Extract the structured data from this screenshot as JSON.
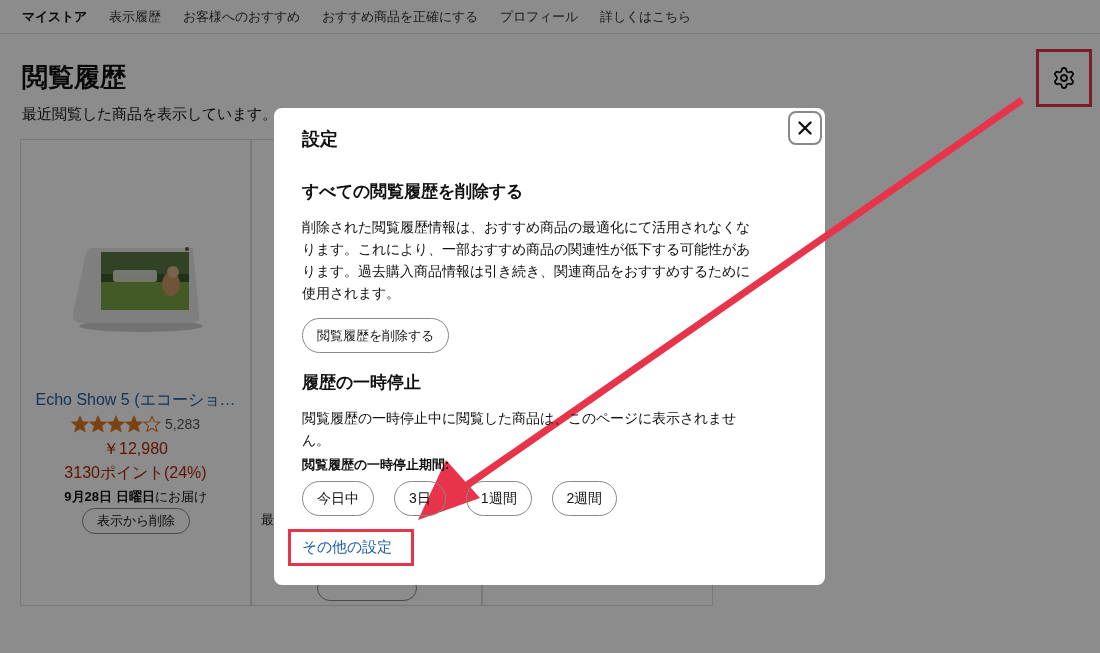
{
  "nav": {
    "items": [
      {
        "label": "マイストア",
        "selected": true
      },
      {
        "label": "表示履歴",
        "selected": false
      },
      {
        "label": "お客様へのおすすめ",
        "selected": false
      },
      {
        "label": "おすすめ商品を正確にする",
        "selected": false
      },
      {
        "label": "プロフィール",
        "selected": false
      },
      {
        "label": "詳しくはこちら",
        "selected": false
      }
    ]
  },
  "page": {
    "title": "閲覧履歴",
    "subtitle": "最近閲覧した商品を表示しています。"
  },
  "products": [
    {
      "kind": "full",
      "name": "Echo Show 5 (エコーショ…",
      "stars": 4,
      "reviews": "5,283",
      "price": "￥12,980",
      "points": "3130ポイント(24%)",
      "delivery_date": "9月28日 日曜日",
      "delivery_suffix": "にお届け",
      "remove": "表示から削除"
    },
    {
      "kind": "covered",
      "text": "最"
    },
    {
      "kind": "empty"
    }
  ],
  "dialog": {
    "title": "設定",
    "sections": [
      {
        "heading": "すべての閲覧履歴を削除する",
        "body": "削除された閲覧履歴情報は、おすすめ商品の最適化にて活用されなくなります。これにより、一部おすすめ商品の関連性が低下する可能性があります。過去購入商品情報は引き続き、関連商品をおすすめするために使用されます。",
        "button": "閲覧履歴を削除する"
      },
      {
        "heading": "履歴の一時停止",
        "body": "閲覧履歴の一時停止中に閲覧した商品は、このページに表示されません。",
        "label": "閲覧履歴の一時停止期間:",
        "options": [
          "今日中",
          "3日",
          "1週間",
          "2週間"
        ]
      }
    ],
    "link": "その他の設定"
  }
}
